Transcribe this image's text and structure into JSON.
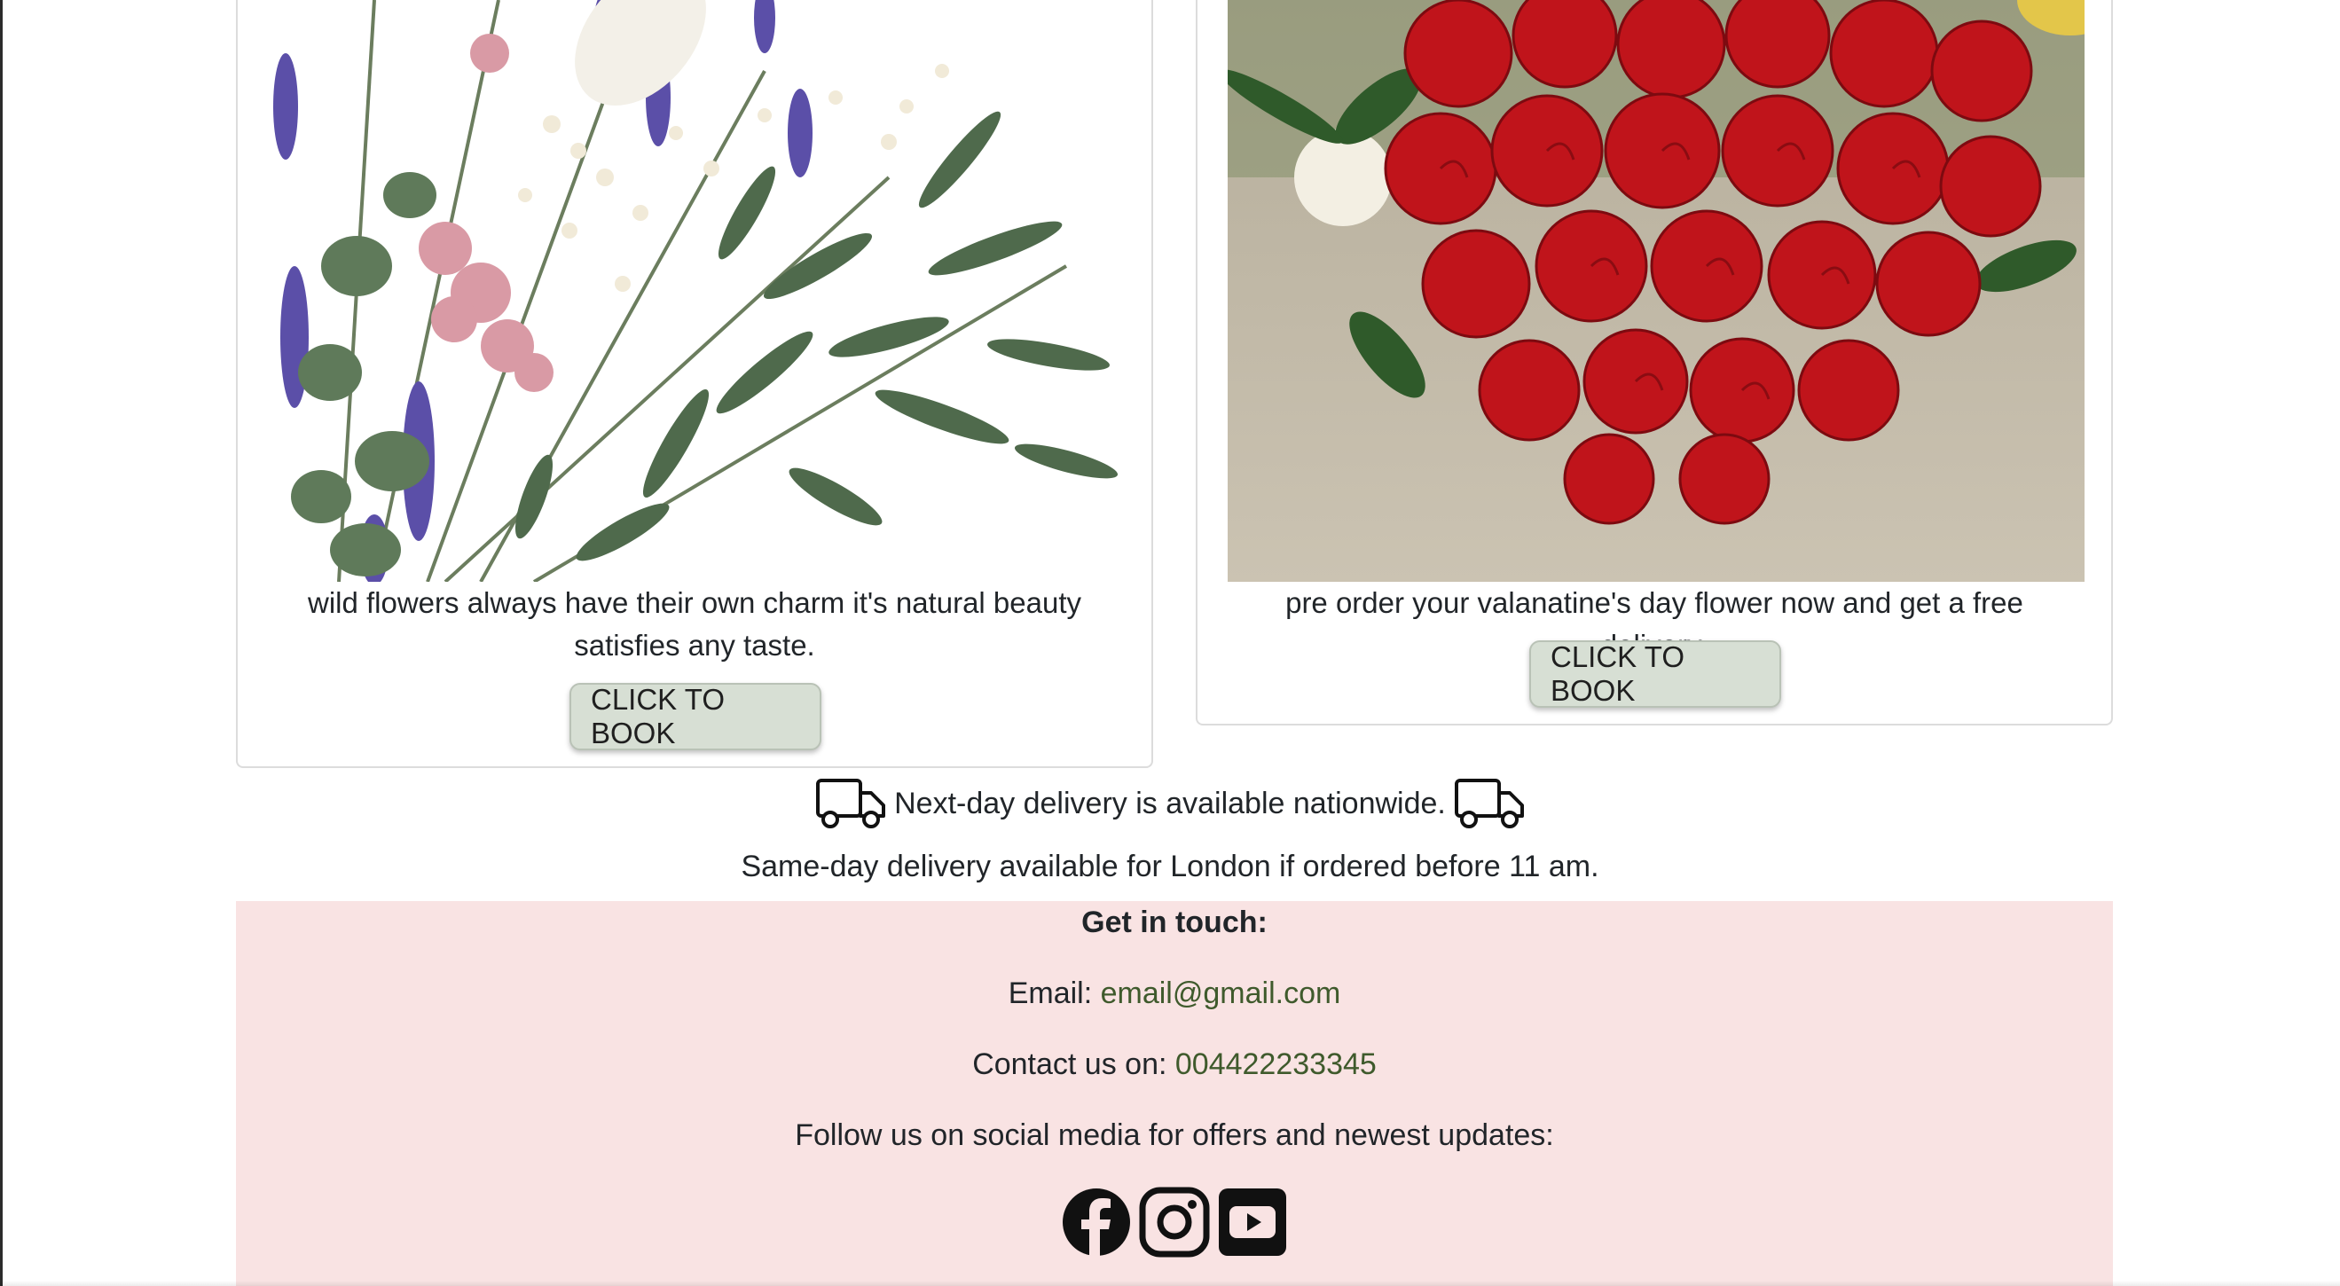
{
  "cards": [
    {
      "image_name": "wildflower-bouquet",
      "description": "wild flowers always have their own charm it's natural beauty satisfies any taste.",
      "button_label": "CLICK TO BOOK"
    },
    {
      "image_name": "red-roses-bouquet",
      "description": "pre order your valanatine's day flower now and get a free delivery.",
      "button_label": "CLICK TO BOOK"
    }
  ],
  "delivery": {
    "nationwide": "Next-day delivery is available nationwide.",
    "same_day": "Same-day delivery available for London if ordered before 11 am.",
    "icon": "truck-icon"
  },
  "footer": {
    "title": "Get in touch:",
    "email_label": "Email:",
    "email": "email@gmail.com",
    "phone_label": "Contact us on:",
    "phone": "004422233345",
    "follow_text": "Follow us on social media for offers and newest updates:",
    "socials": [
      "facebook-icon",
      "instagram-icon",
      "youtube-icon"
    ],
    "background": "#f9e3e3",
    "link_color": "#3f5a2c"
  },
  "colors": {
    "button_bg": "#d7dfd4",
    "rose_red": "#c0141b",
    "foliage_green": "#5f7a5a",
    "lavender": "#5b4fa8"
  }
}
